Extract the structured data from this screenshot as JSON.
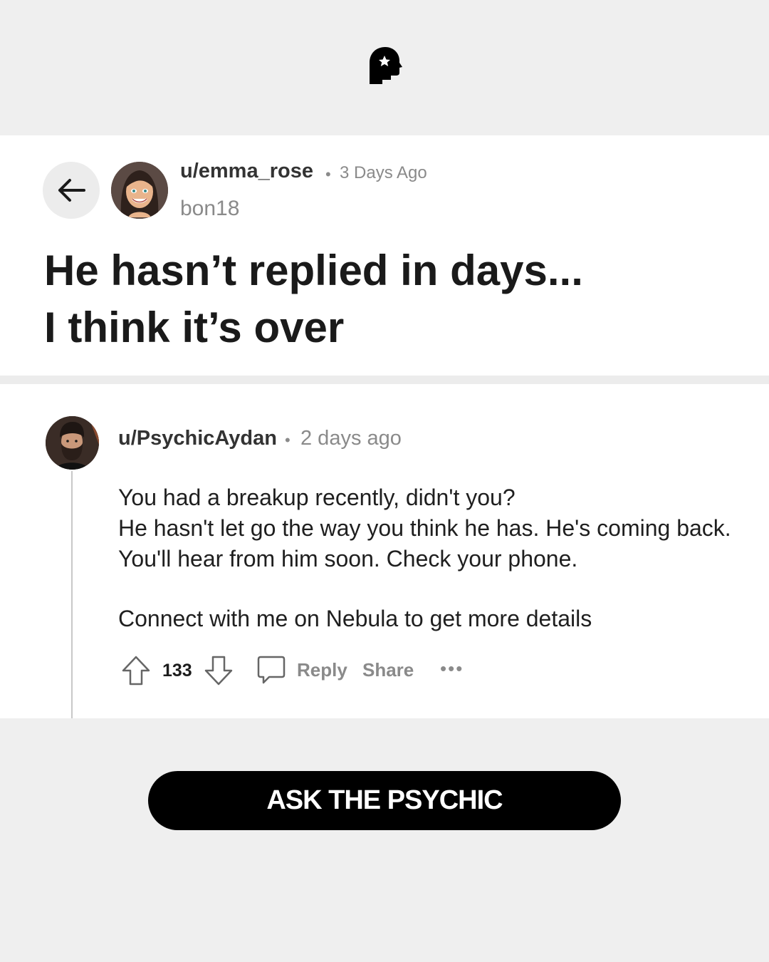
{
  "colors": {
    "page_bg": "#efefef",
    "card_bg": "#ffffff",
    "muted_text": "#8a8a8a",
    "button_bg": "#000000",
    "button_text": "#ffffff"
  },
  "header": {
    "logo_icon": "head-silhouette-star-icon"
  },
  "post": {
    "back_icon": "arrow-left-icon",
    "author": "u/emma_rose",
    "separator": "•",
    "time": "3 Days Ago",
    "subtitle": "bon18",
    "title_line1": "He hasn’t replied in days...",
    "title_line2": "I think it’s over"
  },
  "comment": {
    "author": "u/PsychicAydan",
    "separator": "•",
    "time": "2 days ago",
    "body_lines": [
      "You had a breakup recently, didn't you?",
      "He hasn't let go the way you think he has. He's coming back.  You'll hear from him soon. Check your phone."
    ],
    "cta_line": "Connect with me on Nebula to get more details",
    "votes": "133",
    "reply_label": "Reply",
    "share_label": "Share",
    "more_label": "•••",
    "icons": [
      "upvote-arrow-icon",
      "downvote-arrow-icon",
      "comment-bubble-icon",
      "more-dots-icon"
    ]
  },
  "cta_button": {
    "label": "ASK THE PSYCHIC"
  }
}
